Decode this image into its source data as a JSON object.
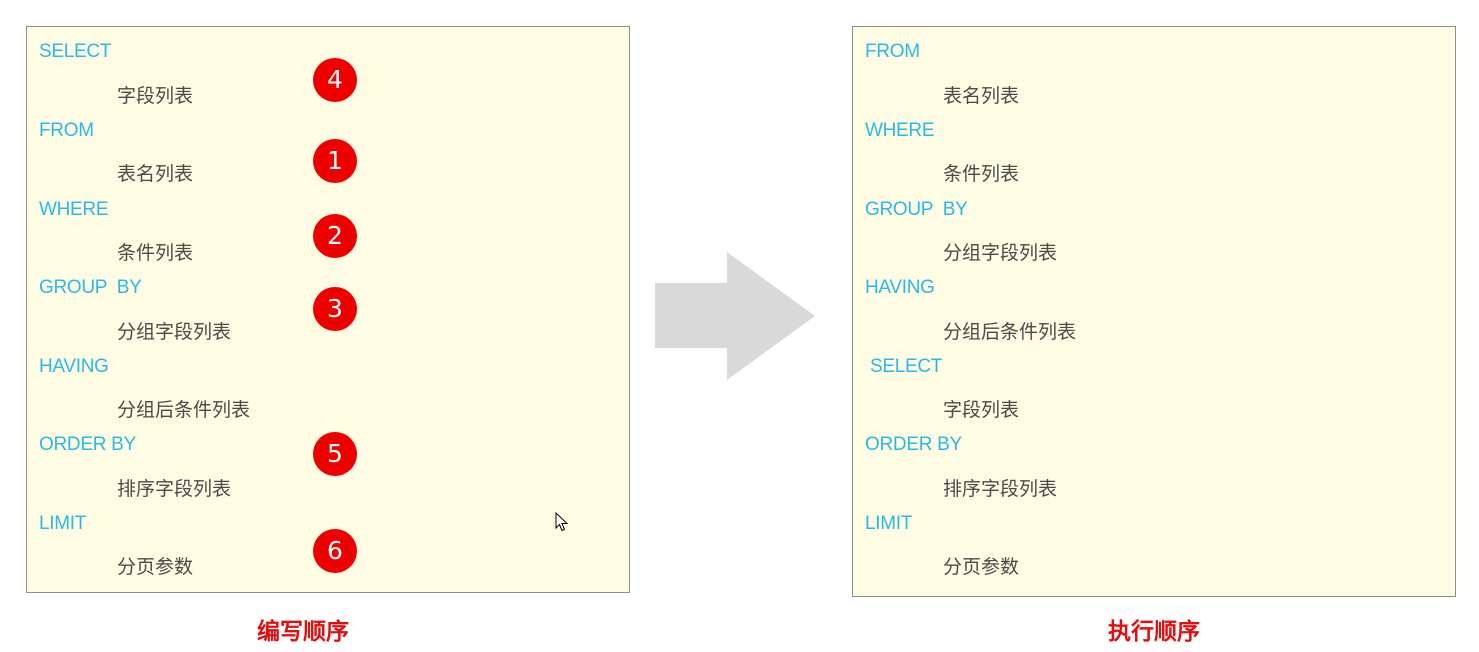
{
  "writing_order": {
    "caption": "编写顺序",
    "clauses": [
      {
        "keyword": "SELECT",
        "description": "字段列表",
        "step": "4"
      },
      {
        "keyword": "FROM",
        "description": "表名列表",
        "step": "1"
      },
      {
        "keyword": "WHERE",
        "description": "条件列表",
        "step": "2"
      },
      {
        "keyword": "GROUP  BY",
        "description": "分组字段列表",
        "step": "3"
      },
      {
        "keyword": "HAVING",
        "description": "分组后条件列表",
        "step": ""
      },
      {
        "keyword": "ORDER BY",
        "description": "排序字段列表",
        "step": "5"
      },
      {
        "keyword": "LIMIT",
        "description": "分页参数",
        "step": "6"
      }
    ]
  },
  "execution_order": {
    "caption": "执行顺序",
    "clauses": [
      {
        "keyword": "FROM",
        "description": "表名列表"
      },
      {
        "keyword": "WHERE",
        "description": "条件列表"
      },
      {
        "keyword": "GROUP  BY",
        "description": "分组字段列表"
      },
      {
        "keyword": "HAVING",
        "description": "分组后条件列表"
      },
      {
        "keyword": " SELECT",
        "description": "字段列表"
      },
      {
        "keyword": "ORDER BY",
        "description": "排序字段列表"
      },
      {
        "keyword": "LIMIT",
        "description": "分页参数"
      }
    ]
  },
  "icons": {
    "arrow": "arrow-right-icon",
    "cursor": "mouse-pointer-icon"
  },
  "colors": {
    "keyword": "#2cb8e6",
    "description": "#4a4a4a",
    "badge": "#ee0000",
    "caption": "#e01010",
    "box_background": "#fefde3",
    "arrow": "#d9d9d9"
  }
}
